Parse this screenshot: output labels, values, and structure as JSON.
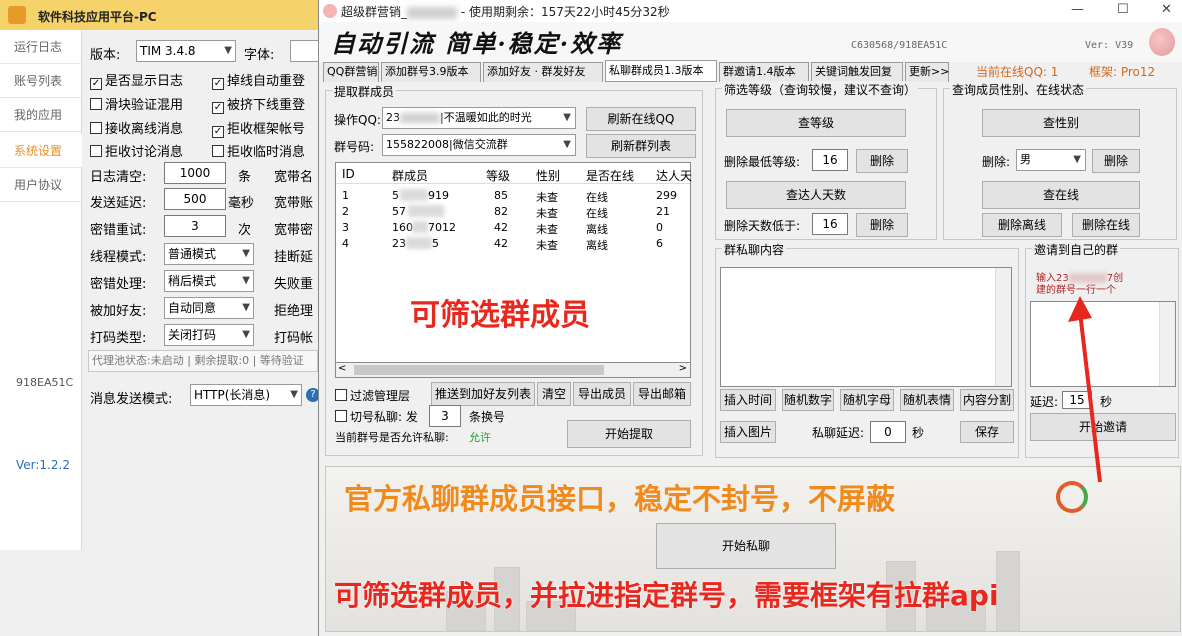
{
  "back_window": {
    "title": "软件科技应用平台-PC",
    "nav": [
      "运行日志",
      "账号列表",
      "我的应用",
      "系统设置",
      "用户协议"
    ],
    "device_id": "918EA51C",
    "version": "Ver:1.2.2",
    "version_label": "版本:",
    "version_value": "TIM  3.4.8",
    "font_label": "字体:",
    "checks": [
      {
        "label": "是否显示日志",
        "checked": true
      },
      {
        "label": "掉线自动重登",
        "checked": true
      },
      {
        "label": "滑块验证混用",
        "checked": false
      },
      {
        "label": "被挤下线重登",
        "checked": true
      },
      {
        "label": "接收离线消息",
        "checked": false
      },
      {
        "label": "拒收框架帐号",
        "checked": true
      },
      {
        "label": "拒收讨论消息",
        "checked": false
      },
      {
        "label": "拒收临时消息",
        "checked": false
      }
    ],
    "log_clear_label": "日志清空:",
    "log_clear_value": "1000",
    "log_clear_unit": "条",
    "send_delay_label": "发送延迟:",
    "send_delay_value": "500",
    "send_delay_unit": "毫秒",
    "pwd_retry_label": "密错重试:",
    "pwd_retry_value": "3",
    "pwd_retry_unit": "次",
    "broadband_1": "宽带名",
    "broadband_2": "宽带账",
    "broadband_3": "宽带密",
    "thread_label": "线程模式:",
    "thread_value": "普通模式",
    "hang_label": "挂断延",
    "pwd_err_label": "密错处理:",
    "pwd_err_value": "稍后模式",
    "fail_label": "失败重",
    "friend_label": "被加好友:",
    "friend_value": "自动同意",
    "reject_label": "拒绝理",
    "captcha_label": "打码类型:",
    "captcha_value": "关闭打码",
    "captcha_acc_label": "打码帐",
    "proxy_status": "代理池状态:未启动 | 剩余提取:0 | 等待验证",
    "msg_mode_label": "消息发送模式:",
    "msg_mode_value": "HTTP(长消息)"
  },
  "main_window": {
    "title": "超级群营销_",
    "title_suffix": " - 使用期剩余：157天22小时45分32秒",
    "slogan": "自动引流 简单·稳定·效率",
    "code": "C630568/918EA51C",
    "version": "Ver: V39",
    "tabs": [
      "QQ群营销",
      "添加群号3.9版本",
      "添加好友 · 群发好友",
      "私聊群成员1.3版本",
      "群邀请1.4版本",
      "关键词触发回复",
      "更新>>"
    ],
    "online_qq": "当前在线QQ: 1",
    "frame": "框架: Pro12",
    "extract": {
      "title": "提取群成员",
      "op_qq_label": "操作QQ:",
      "op_qq_value": "23",
      "op_qq_suffix": "|不温暖如此的时光",
      "group_label": "群号码:",
      "group_value": "155822008|微信交流群",
      "refresh_online": "刷新在线QQ",
      "refresh_groups": "刷新群列表",
      "headers": [
        "ID",
        "群成员",
        "等级",
        "性别",
        "是否在线",
        "达人天"
      ],
      "rows": [
        [
          "1",
          "5",
          "919",
          "85",
          "未查",
          "在线",
          "299"
        ],
        [
          "2",
          "57",
          "",
          "82",
          "未查",
          "在线",
          "21"
        ],
        [
          "3",
          "160",
          "7012",
          "42",
          "未查",
          "离线",
          "0"
        ],
        [
          "4",
          "23",
          "5",
          "42",
          "未查",
          "离线",
          "6"
        ]
      ],
      "filter_admin": "过滤管理层",
      "push_friends": "推送到加好友列表",
      "clear": "清空",
      "export_members": "导出成员",
      "export_mail": "导出邮箱",
      "switch_label": "切号私聊: 发",
      "switch_value": "3",
      "switch_unit": "条换号",
      "allow_label": "当前群号是否允许私聊:",
      "allow_value": "允许",
      "start_extract": "开始提取"
    },
    "filter_level": {
      "title": "筛选等级（查询较慢，建议不查询）",
      "check_level": "查等级",
      "min_level_label": "删除最低等级:",
      "min_level_value": "16",
      "delete": "删除",
      "check_days": "查达人天数",
      "min_days_label": "删除天数低于:",
      "min_days_value": "16"
    },
    "gender": {
      "title": "查询成员性别、在线状态",
      "check_gender": "查性别",
      "delete_label": "删除:",
      "gender_value": "男",
      "delete": "删除",
      "check_online": "查在线",
      "delete_offline": "删除离线",
      "delete_online": "删除在线"
    },
    "private": {
      "title": "群私聊内容",
      "insert_time": "插入时间",
      "rand_num": "随机数字",
      "rand_letter": "随机字母",
      "rand_emoji": "随机表情",
      "split": "内容分割",
      "insert_img": "插入图片",
      "delay_label": "私聊延迟:",
      "delay_value": "0",
      "delay_unit": "秒",
      "save": "保存",
      "start_private": "开始私聊"
    },
    "invite": {
      "title": "邀请到自己的群",
      "hint": "输入23",
      "hint_2": "7创",
      "hint_3": "建的群号一行一个",
      "delay_label": "延迟:",
      "delay_value": "15",
      "delay_unit": "秒",
      "start_invite": "开始邀请"
    }
  },
  "overlays": {
    "filter_members": "可筛选群成员",
    "official_api": "官方私聊群成员接口，稳定不封号，不屏蔽",
    "pull_group": "可筛选群成员，并拉进指定群号，需要框架有拉群api"
  },
  "colors": {
    "accent_orange": "#e8902a",
    "overlay_red": "#e8281e",
    "title_yellow": "#f5d36a",
    "online_orange": "#d2691e"
  }
}
